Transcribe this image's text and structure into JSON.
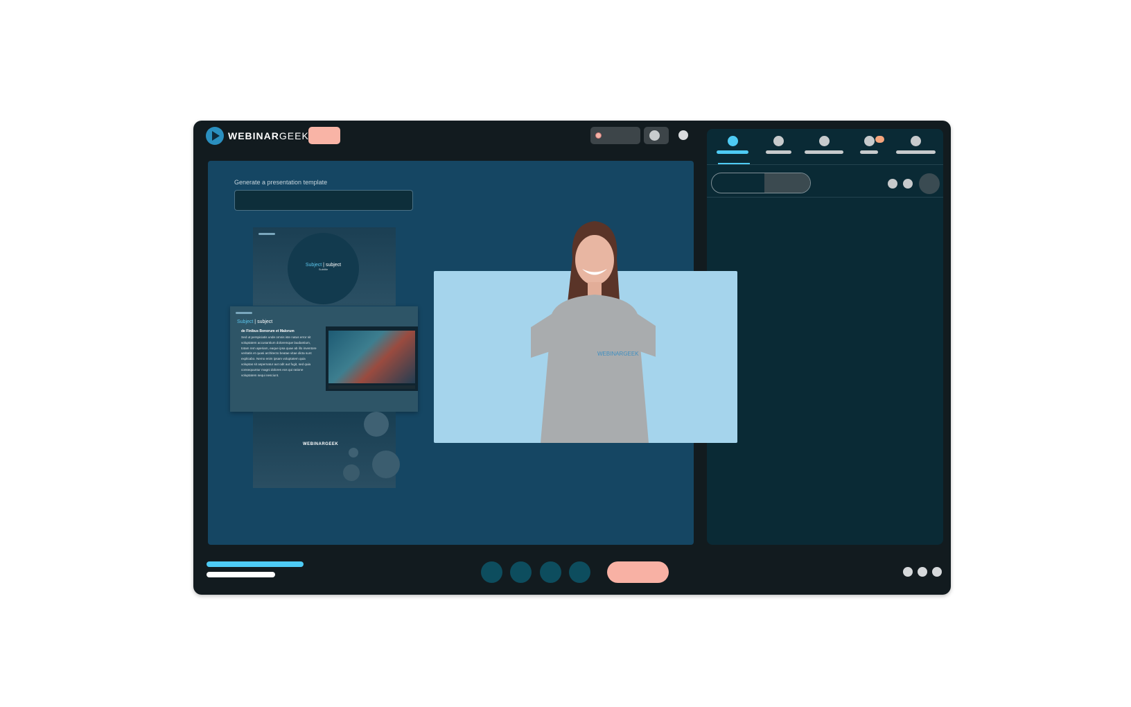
{
  "app": {
    "brand": "WEBINAR",
    "brand_light": "GEEK"
  },
  "stage": {
    "generate_label": "Generate a presentation template",
    "generate_input_value": ""
  },
  "slides": {
    "cover": {
      "subject_accent": "Subject",
      "subject_rest": " | subject",
      "subtitle": "Subtitle"
    },
    "content": {
      "subject_accent": "Subject",
      "subject_rest": " | subject",
      "heading": "de Finibus Bonorum et Malorum",
      "body": "Sed ut perspiciatis unde omnis iste natus error sit voluptatem accusantium doloremque laudantium, totam rem aperiam, eaque ipsa quae ab illo inventore veritatis et quasi architecto beatae vitae dicta sunt explicabo. Nemo enim ipsam voluptatem quia voluptas sit aspernatur aut odit aut fugit, sed quia consequuntur magni dolores eos qui ratione voluptatem sequi nesciunt."
    },
    "end": {
      "logo_text": "WEBINARGEEK"
    }
  },
  "presenter": {
    "sweater_logo": "WEBINARGEEK"
  },
  "colors": {
    "accent": "#4ecbf4",
    "cta": "#f8b1a4",
    "stage_bg": "#154663",
    "panel_bg": "#0a2a35",
    "frame_bg": "#121b1f"
  },
  "icons": [
    "record-dot-icon",
    "camera-toggle-icon",
    "logo-play-icon"
  ]
}
